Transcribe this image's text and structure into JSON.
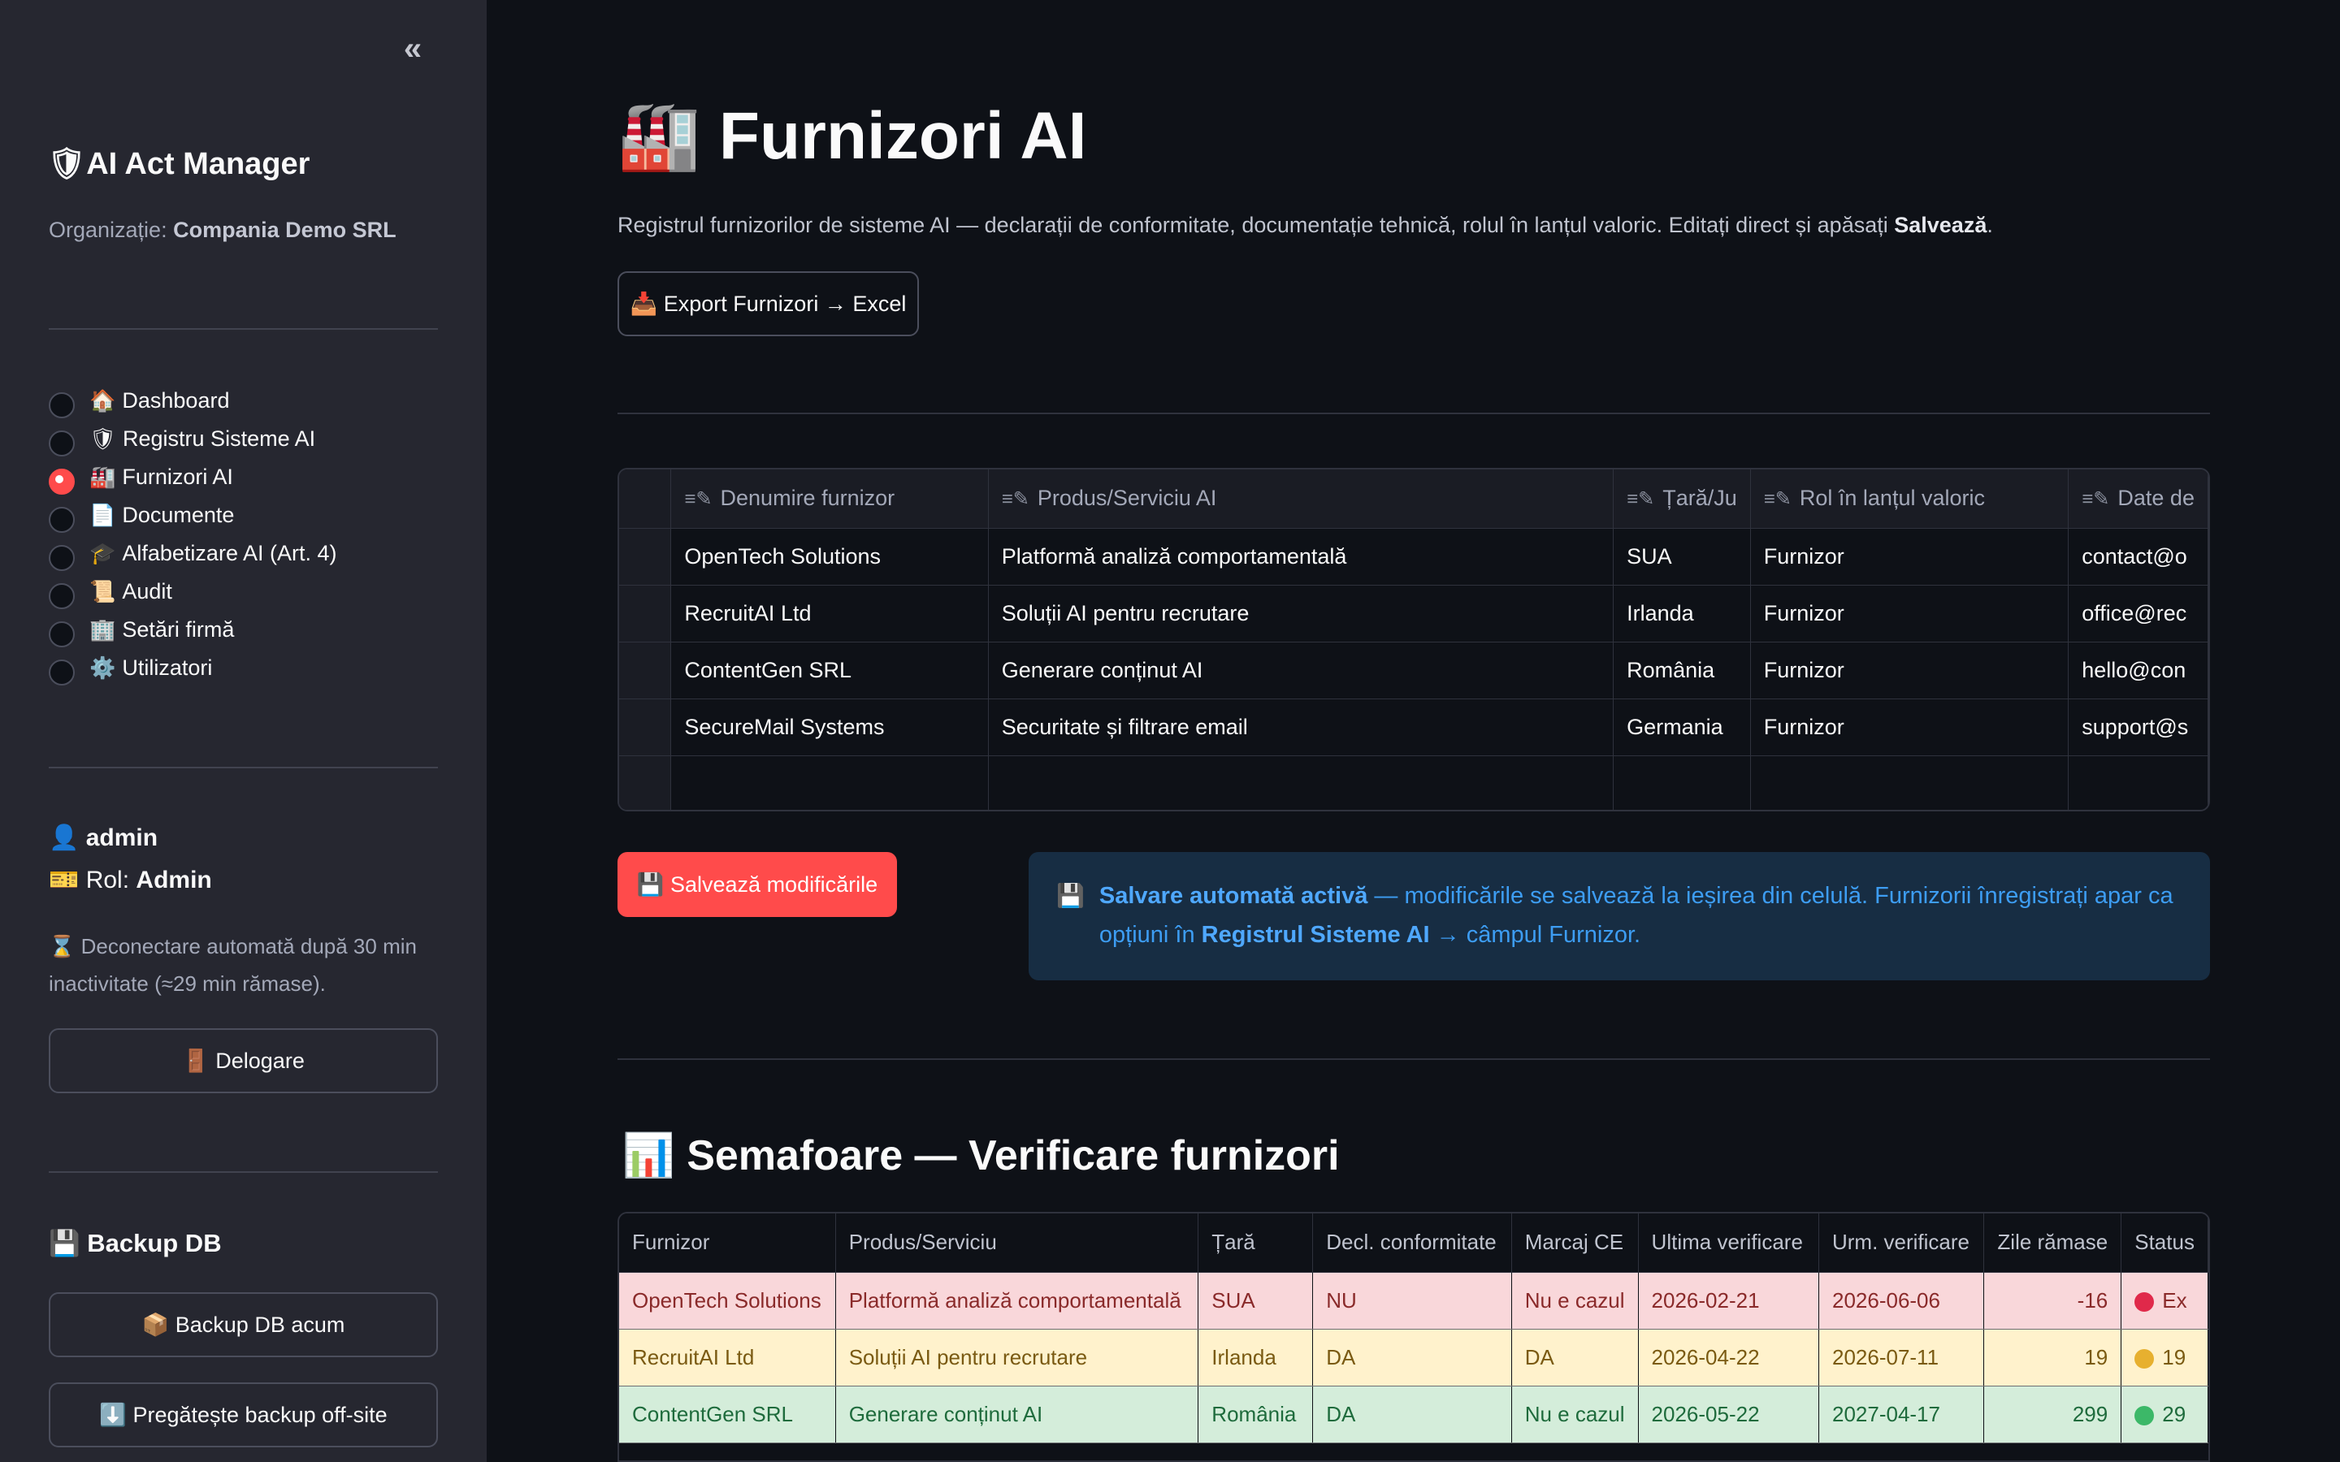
{
  "sidebar": {
    "collapse_icon": "«",
    "app_title": "🛡AI Act Manager",
    "org_label": "Organizație:",
    "org_name": "Compania Demo SRL",
    "nav": [
      {
        "icon": "🏠",
        "label": "Dashboard",
        "selected": false
      },
      {
        "icon": "🛡",
        "label": "Registru Sisteme AI",
        "selected": false
      },
      {
        "icon": "🏭",
        "label": "Furnizori AI",
        "selected": true
      },
      {
        "icon": "📄",
        "label": "Documente",
        "selected": false
      },
      {
        "icon": "🎓",
        "label": "Alfabetizare AI (Art. 4)",
        "selected": false
      },
      {
        "icon": "📜",
        "label": "Audit",
        "selected": false
      },
      {
        "icon": "🏢",
        "label": "Setări firmă",
        "selected": false
      },
      {
        "icon": "⚙️",
        "label": "Utilizatori",
        "selected": false
      }
    ],
    "user_icon": "👤",
    "user_name": "admin",
    "role_icon": "🎫",
    "role_label": "Rol:",
    "role_value": "Admin",
    "timeout_text": "⌛ Deconectare automată după 30 min inactivitate (≈29 min rămase).",
    "logout_label": "🚪 Delogare",
    "backup_title": "💾 Backup DB",
    "backup_now_label": "📦 Backup DB acum",
    "backup_offsite_label": "⬇️ Pregătește backup off-site"
  },
  "main": {
    "title": "🏭 Furnizori AI",
    "description": "Registrul furnizorilor de sisteme AI — declarații de conformitate, documentație tehnică, rolul în lanțul valoric. Editați direct și apăsați",
    "description_bold": "Salvează",
    "export_label": "📥 Export Furnizori → Excel",
    "editor": {
      "columns": [
        "Denumire furnizor",
        "Produs/Serviciu AI",
        "Țară/Ju",
        "Rol în lanțul valoric",
        "Date de"
      ],
      "rows": [
        [
          "OpenTech Solutions",
          "Platformă analiză comportamentală",
          "SUA",
          "Furnizor",
          "contact@o"
        ],
        [
          "RecruitAI Ltd",
          "Soluții AI pentru recrutare",
          "Irlanda",
          "Furnizor",
          "office@rec"
        ],
        [
          "ContentGen SRL",
          "Generare conținut AI",
          "România",
          "Furnizor",
          "hello@con"
        ],
        [
          "SecureMail Systems",
          "Securitate și filtrare email",
          "Germania",
          "Furnizor",
          "support@s"
        ]
      ]
    },
    "save_label": "💾 Salvează modificările",
    "info": {
      "icon": "💾",
      "bold1": "Salvare automată activă",
      "text1": " — modificările se salvează la ieșirea din celulă. Furnizorii înregistrați apar ca opțiuni în ",
      "bold2": "Registrul Sisteme AI",
      "text2": " → câmpul Furnizor."
    },
    "section_title": "📊 Semafoare — Verificare furnizori",
    "status_table": {
      "columns": [
        "Furnizor",
        "Produs/Serviciu",
        "Țară",
        "Decl. conformitate",
        "Marcaj CE",
        "Ultima verificare",
        "Urm. verificare",
        "Zile rămase",
        "Status"
      ],
      "rows": [
        {
          "level": "red",
          "dot": "#e0294a",
          "cells": [
            "OpenTech Solutions",
            "Platformă analiză comportamentală",
            "SUA",
            "NU",
            "Nu e cazul",
            "2026-02-21",
            "2026-06-06",
            "-16",
            "Ex"
          ]
        },
        {
          "level": "yellow",
          "dot": "#e7b02f",
          "cells": [
            "RecruitAI Ltd",
            "Soluții AI pentru recrutare",
            "Irlanda",
            "DA",
            "DA",
            "2026-04-22",
            "2026-07-11",
            "19",
            "19"
          ]
        },
        {
          "level": "green",
          "dot": "#3cb868",
          "cells": [
            "ContentGen SRL",
            "Generare conținut AI",
            "România",
            "DA",
            "Nu e cazul",
            "2026-05-22",
            "2027-04-17",
            "299",
            "29"
          ]
        }
      ]
    }
  }
}
